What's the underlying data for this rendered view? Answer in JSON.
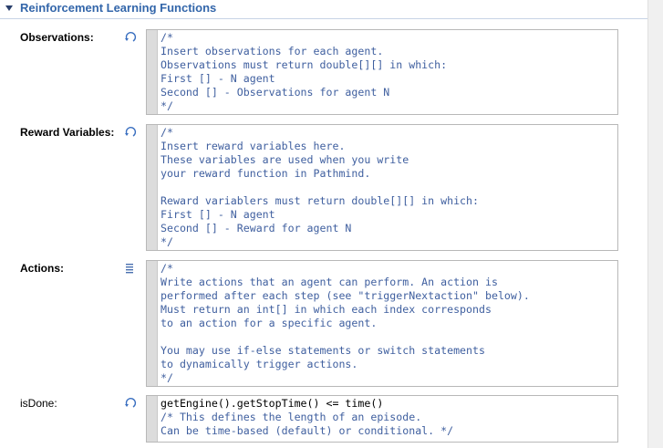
{
  "section": {
    "title": "Reinforcement Learning Functions"
  },
  "fields": [
    {
      "label": "Observations:",
      "icon": "dynamic-refresh-icon",
      "code": [
        {
          "text": "/*",
          "cls": "c"
        },
        {
          "text": "Insert observations for each agent.",
          "cls": "c"
        },
        {
          "text": "Observations must return double[][] in which:",
          "cls": "c"
        },
        {
          "text": "First [] - N agent",
          "cls": "c"
        },
        {
          "text": "Second [] - Observations for agent N",
          "cls": "c"
        },
        {
          "text": "*/",
          "cls": "c"
        }
      ]
    },
    {
      "label": "Reward Variables:",
      "icon": "dynamic-refresh-icon",
      "code": [
        {
          "text": "/*",
          "cls": "c"
        },
        {
          "text": "Insert reward variables here.",
          "cls": "c"
        },
        {
          "text": "These variables are used when you write",
          "cls": "c"
        },
        {
          "text": "your reward function in Pathmind.",
          "cls": "c"
        },
        {
          "text": "",
          "cls": "c"
        },
        {
          "text": "Reward variablers must return double[][] in which:",
          "cls": "c"
        },
        {
          "text": "First [] - N agent",
          "cls": "c"
        },
        {
          "text": "Second [] - Reward for agent N",
          "cls": "c"
        },
        {
          "text": "*/",
          "cls": "c"
        }
      ]
    },
    {
      "label": "Actions:",
      "icon": "action-list-icon",
      "code": [
        {
          "text": "/*",
          "cls": "c"
        },
        {
          "text": "Write actions that an agent can perform. An action is",
          "cls": "c"
        },
        {
          "text": "performed after each step (see \"triggerNextaction\" below).",
          "cls": "c"
        },
        {
          "text": "Must return an int[] in which each index corresponds",
          "cls": "c"
        },
        {
          "text": "to an action for a specific agent.",
          "cls": "c"
        },
        {
          "text": "",
          "cls": "c"
        },
        {
          "text": "You may use if-else statements or switch statements",
          "cls": "c"
        },
        {
          "text": "to dynamically trigger actions.",
          "cls": "c"
        },
        {
          "text": "*/",
          "cls": "c"
        }
      ]
    },
    {
      "label": "isDone:",
      "icon": "dynamic-refresh-icon",
      "code": [
        {
          "text": "getEngine().getStopTime() <= time()",
          "cls": "k"
        },
        {
          "text": "/* This defines the length of an episode.",
          "cls": "c"
        },
        {
          "text": "Can be time-based (default) or conditional. */",
          "cls": "c"
        }
      ]
    }
  ]
}
